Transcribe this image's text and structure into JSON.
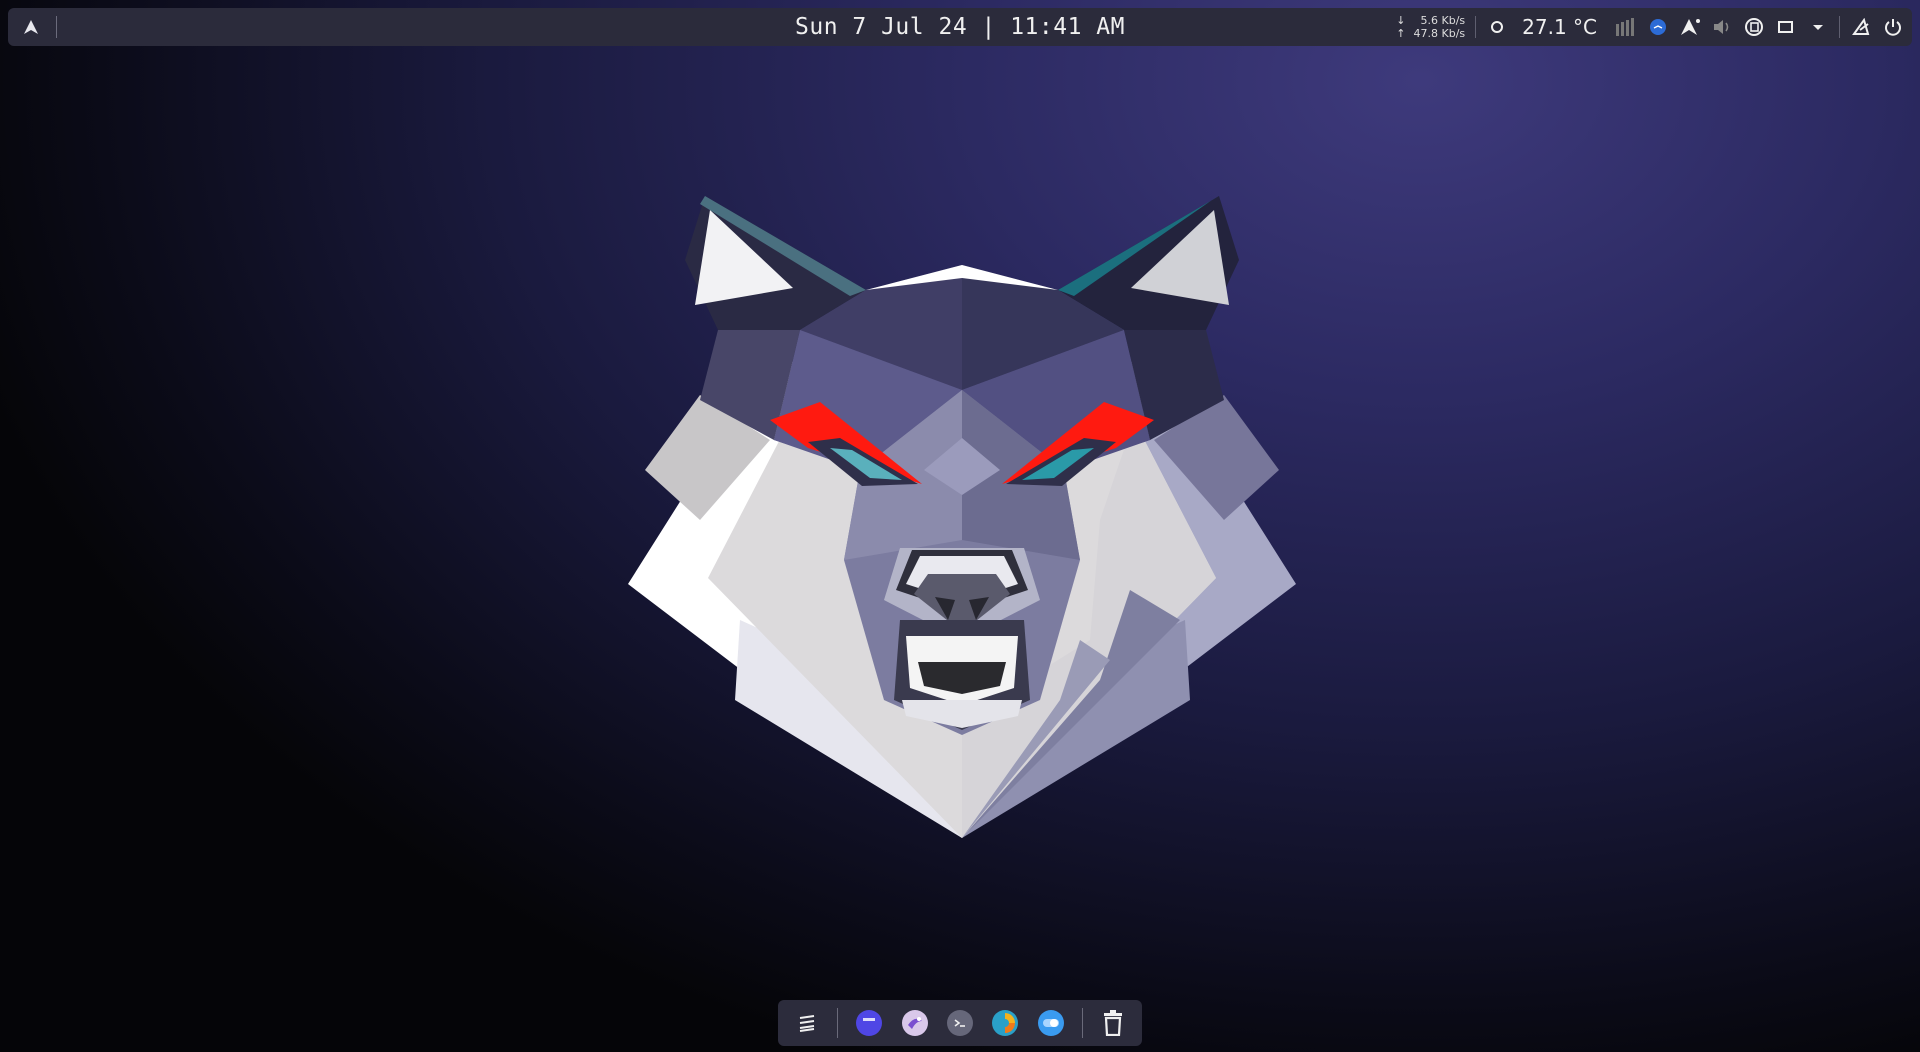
{
  "topbar": {
    "clock": "Sun 7 Jul 24 | 11:41 AM",
    "net_down_arrow": "↓",
    "net_up_arrow": "↑",
    "net_down": "5.6 Kb/s",
    "net_up": "47.8 Kb/s",
    "temperature": "27.1 °C",
    "left_icon": "arch-logo-icon",
    "tray_icons": [
      "cpu-ring-icon",
      "memory-icon",
      "app-indicator-icon",
      "arch-update-icon",
      "volume-icon",
      "clipboard-icon",
      "display-icon",
      "dropdown-icon",
      "settings-icon",
      "power-icon"
    ]
  },
  "wallpaper": {
    "subject": "wolf-head-icon"
  },
  "dock": {
    "items": [
      "app-grid-icon",
      "files-icon",
      "email-client-icon",
      "terminal-icon",
      "browser-icon",
      "toggle-app-icon",
      "trash-icon"
    ]
  },
  "colors": {
    "bar": "#2b2b3b",
    "accent": "#f00e14",
    "teal": "#2a8f9c"
  }
}
